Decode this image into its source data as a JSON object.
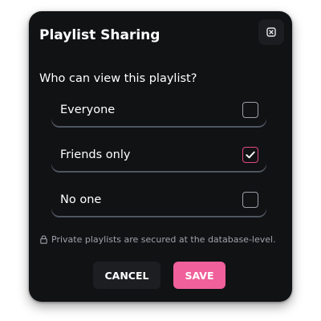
{
  "dialog": {
    "title": "Playlist Sharing",
    "close_icon": "close-icon",
    "question": "Who can view this playlist?",
    "options": [
      {
        "label": "Everyone",
        "checked": false
      },
      {
        "label": "Friends only",
        "checked": true
      },
      {
        "label": "No one",
        "checked": false
      }
    ],
    "note": {
      "icon": "lock-icon",
      "text": "Private playlists are secured at the database-level."
    },
    "buttons": {
      "cancel_label": "CANCEL",
      "save_label": "SAVE"
    }
  },
  "colors": {
    "background": "#111214",
    "accent": "#f0609a",
    "checkbox_checked_border": "#e04a82",
    "divider": "#4e5660",
    "muted_text": "#9ea3ab"
  }
}
